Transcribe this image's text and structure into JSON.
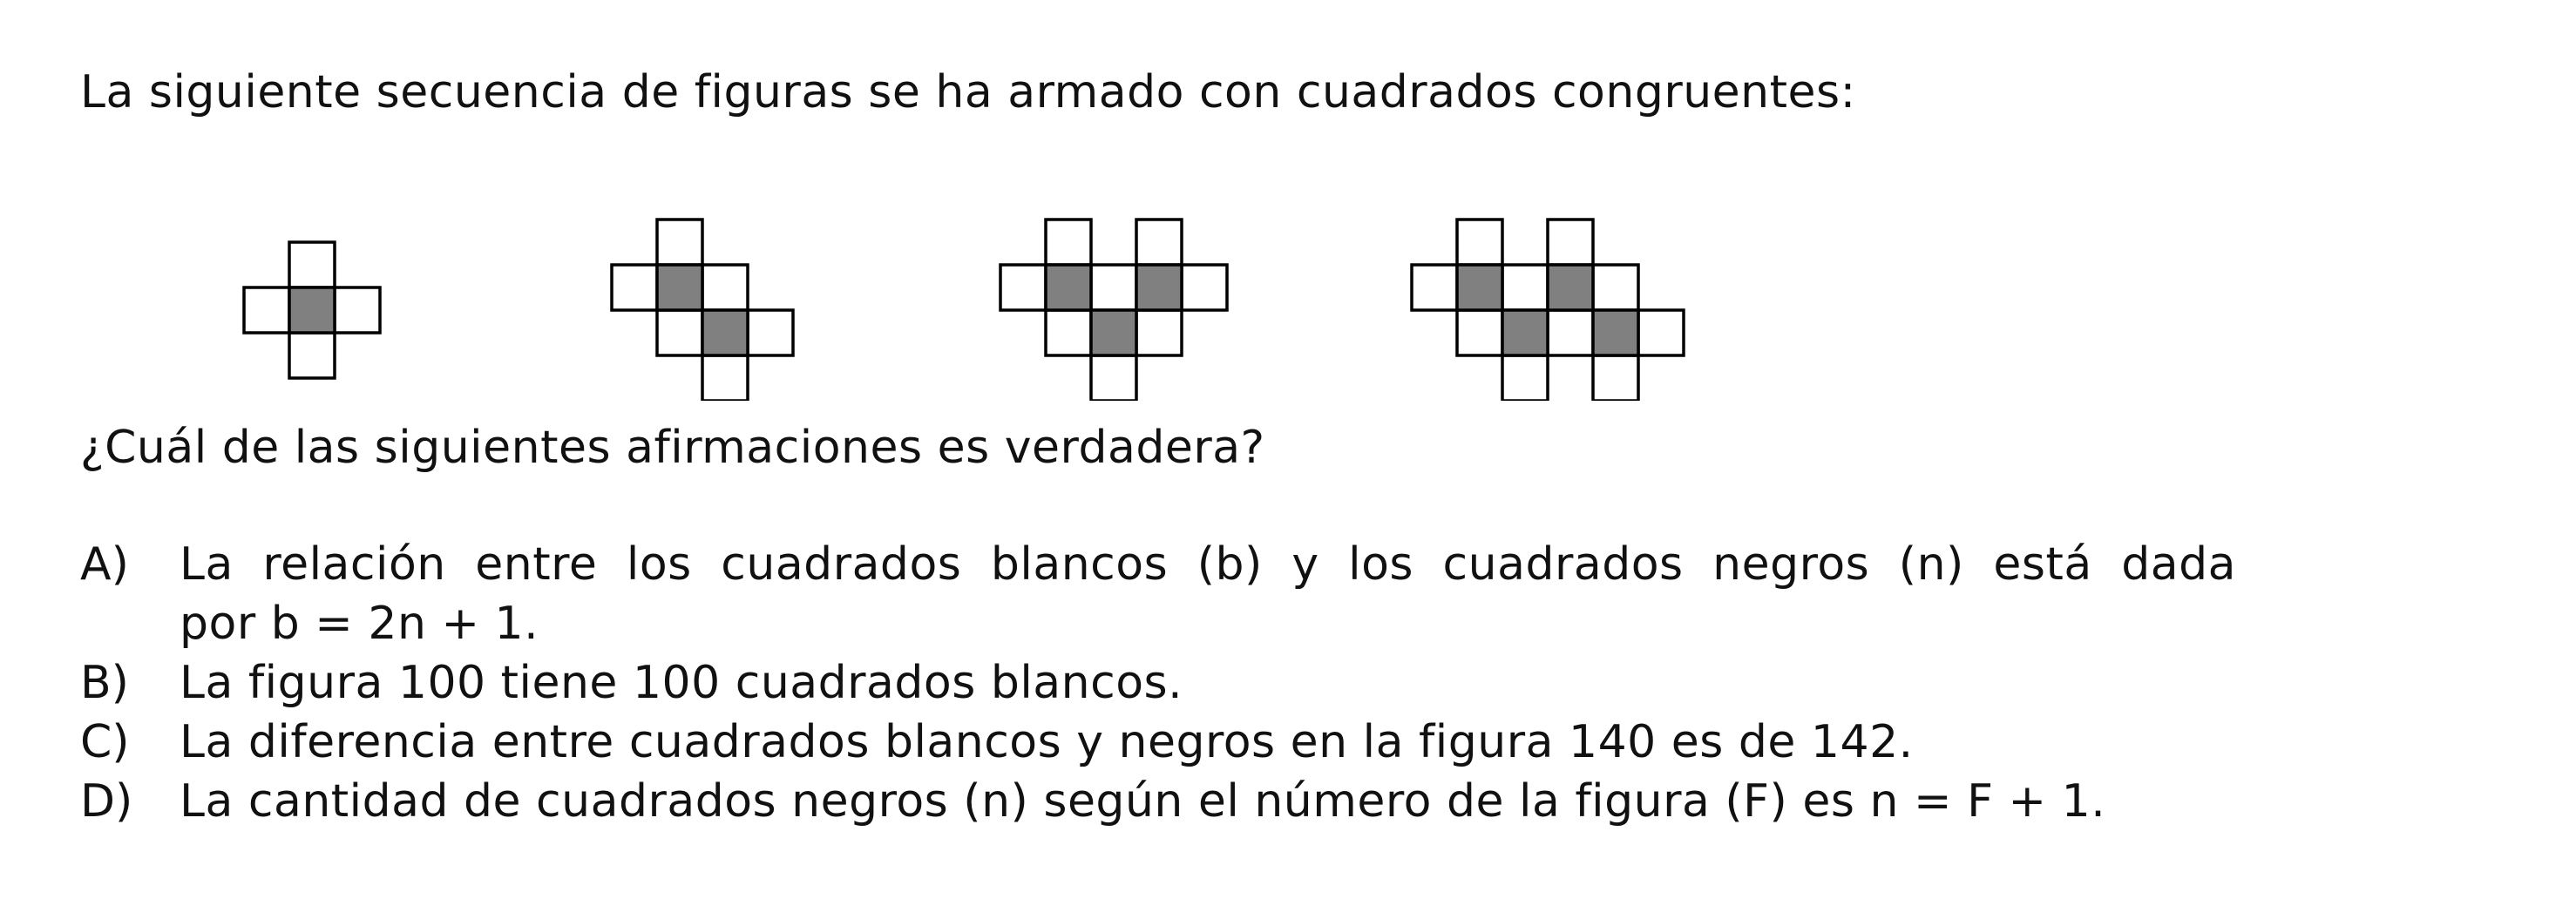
{
  "intro": "La siguiente secuencia de figuras se ha armado con cuadrados congruentes:",
  "figures": [
    {
      "white": 4,
      "dark": 1
    },
    {
      "white": 6,
      "dark": 2
    },
    {
      "white": 8,
      "dark": 3
    },
    {
      "white": 10,
      "dark": 4
    }
  ],
  "question": "¿Cuál de las siguientes afirmaciones es verdadera?",
  "options": [
    {
      "letter": "A)",
      "line1": "La relación entre los cuadrados blancos (b) y los cuadrados negros (n) está dada",
      "line2": "por b = 2n + 1."
    },
    {
      "letter": "B)",
      "text": "La figura 100 tiene 100 cuadrados blancos."
    },
    {
      "letter": "C)",
      "text": "La diferencia entre cuadrados blancos y negros en la figura 140 es de 142."
    },
    {
      "letter": "D)",
      "text": "La cantidad de cuadrados negros (n) según el número de la figura (F) es n = F + 1."
    }
  ],
  "colors": {
    "dark_square": "#808080",
    "white_square": "#ffffff",
    "outline": "#000000"
  }
}
